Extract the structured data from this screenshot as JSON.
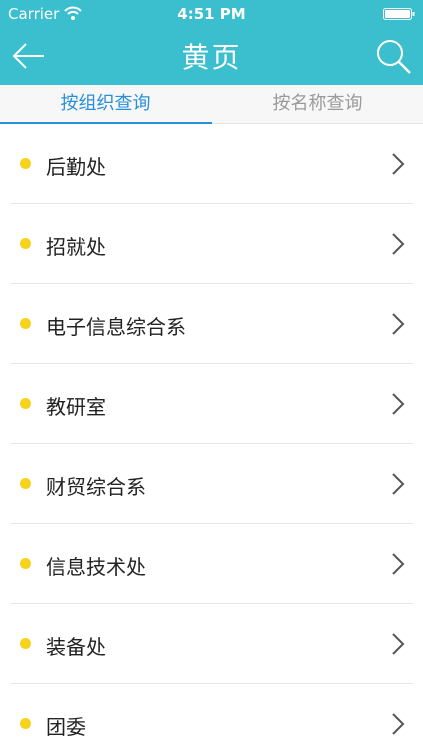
{
  "status_bar": {
    "carrier": "Carrier",
    "time": "4:51 PM"
  },
  "nav": {
    "title": "黄页",
    "back_icon": "back-arrow-icon",
    "search_icon": "search-icon"
  },
  "tabs": [
    {
      "label": "按组织查询",
      "active": true
    },
    {
      "label": "按名称查询",
      "active": false
    }
  ],
  "list": {
    "items": [
      {
        "label": "后勤处"
      },
      {
        "label": "招就处"
      },
      {
        "label": "电子信息综合系"
      },
      {
        "label": "教研室"
      },
      {
        "label": "财贸综合系"
      },
      {
        "label": "信息技术处"
      },
      {
        "label": "装备处"
      },
      {
        "label": "团委"
      }
    ]
  },
  "colors": {
    "header_bg": "#3bbecd",
    "active_tab": "#2a8fd9",
    "inactive_tab": "#9a9a9a",
    "bullet": "#f7d21b"
  }
}
